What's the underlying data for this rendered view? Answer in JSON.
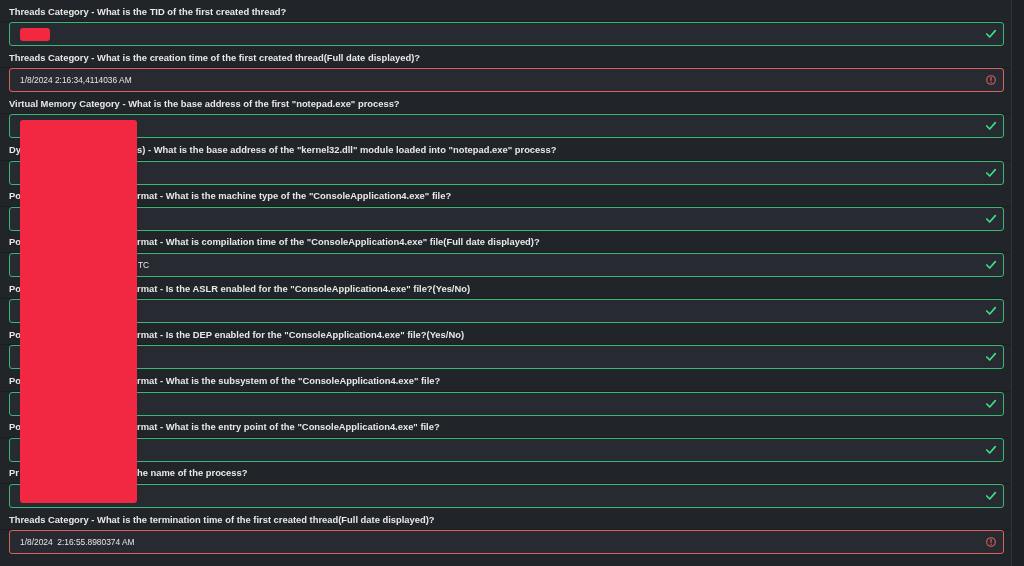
{
  "redaction_overlay": true,
  "questions": [
    {
      "label": "Threads Category - What is the TID of the first created thread?",
      "answer": {
        "redacted": true
      },
      "correct": true
    },
    {
      "label": "Threads Category - What is the creation time of the first created thread(Full date displayed)?",
      "answer": {
        "value": "1/8/2024 2:16:34,4114036 AM"
      },
      "correct": false
    },
    {
      "label": "Virtual Memory Category - What is the base address of the first \"notepad.exe\" process?",
      "correct": true
    },
    {
      "label_start": "Dy",
      "label_end": "s) - What is the base address of the \"kernel32.dll\" module loaded into \"notepad.exe\" process?",
      "correct": true
    },
    {
      "label_start": "Po",
      "label_end": "rmat - What is the machine type of the \"ConsoleApplication4.exe\" file?",
      "correct": true
    },
    {
      "label_start": "Po",
      "label_end": "rmat - What is compilation time of the \"ConsoleApplication4.exe\" file(Full date displayed)?",
      "answer": {
        "value_end": "TC"
      },
      "correct": true
    },
    {
      "label_start": "Po",
      "label_end": "rmat - Is the ASLR enabled for the \"ConsoleApplication4.exe\" file?(Yes/No)",
      "correct": true
    },
    {
      "label_start": "Po",
      "label_end": "rmat - Is the DEP enabled for the \"ConsoleApplication4.exe\" file?(Yes/No)",
      "correct": true
    },
    {
      "label_start": "Po",
      "label_end": "rmat - What is the subsystem of the \"ConsoleApplication4.exe\" file?",
      "correct": true
    },
    {
      "label_start": "Po",
      "label_end": "rmat - What is the entry point of the \"ConsoleApplication4.exe\" file?",
      "correct": true
    },
    {
      "label_start": "Pr",
      "label_end": "he name of the process?",
      "correct": true
    },
    {
      "label": "Threads Category - What is the termination time of the first created thread(Full date displayed)?",
      "answer": {
        "value": "1/8/2024  2:16:55.8980374 AM"
      },
      "correct": false
    }
  ]
}
